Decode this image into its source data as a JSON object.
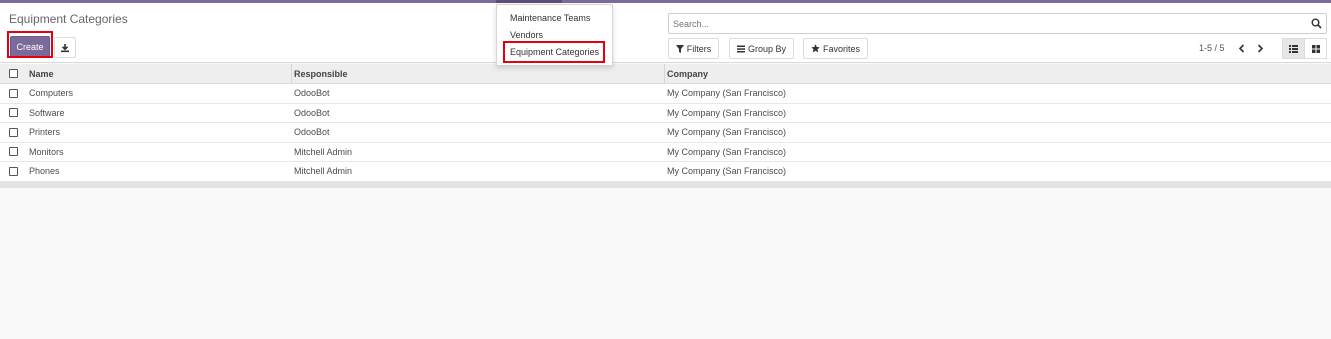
{
  "page": {
    "title": "Equipment Categories",
    "create_label": "Create",
    "colors": {
      "primary": "#7c6b9a",
      "highlight": "#e3000f"
    }
  },
  "search": {
    "placeholder": "Search..."
  },
  "filters": {
    "filters_label": "Filters",
    "groupby_label": "Group By",
    "favorites_label": "Favorites"
  },
  "pager": {
    "text": "1-5 / 5"
  },
  "dropdown": {
    "items": [
      {
        "label": "Maintenance Teams"
      },
      {
        "label": "Vendors"
      },
      {
        "label": "Equipment Categories"
      }
    ]
  },
  "table": {
    "headers": {
      "name": "Name",
      "responsible": "Responsible",
      "company": "Company"
    },
    "rows": [
      {
        "name": "Computers",
        "responsible": "OdooBot",
        "company": "My Company (San Francisco)"
      },
      {
        "name": "Software",
        "responsible": "OdooBot",
        "company": "My Company (San Francisco)"
      },
      {
        "name": "Printers",
        "responsible": "OdooBot",
        "company": "My Company (San Francisco)"
      },
      {
        "name": "Monitors",
        "responsible": "Mitchell Admin",
        "company": "My Company (San Francisco)"
      },
      {
        "name": "Phones",
        "responsible": "Mitchell Admin",
        "company": "My Company (San Francisco)"
      }
    ]
  }
}
